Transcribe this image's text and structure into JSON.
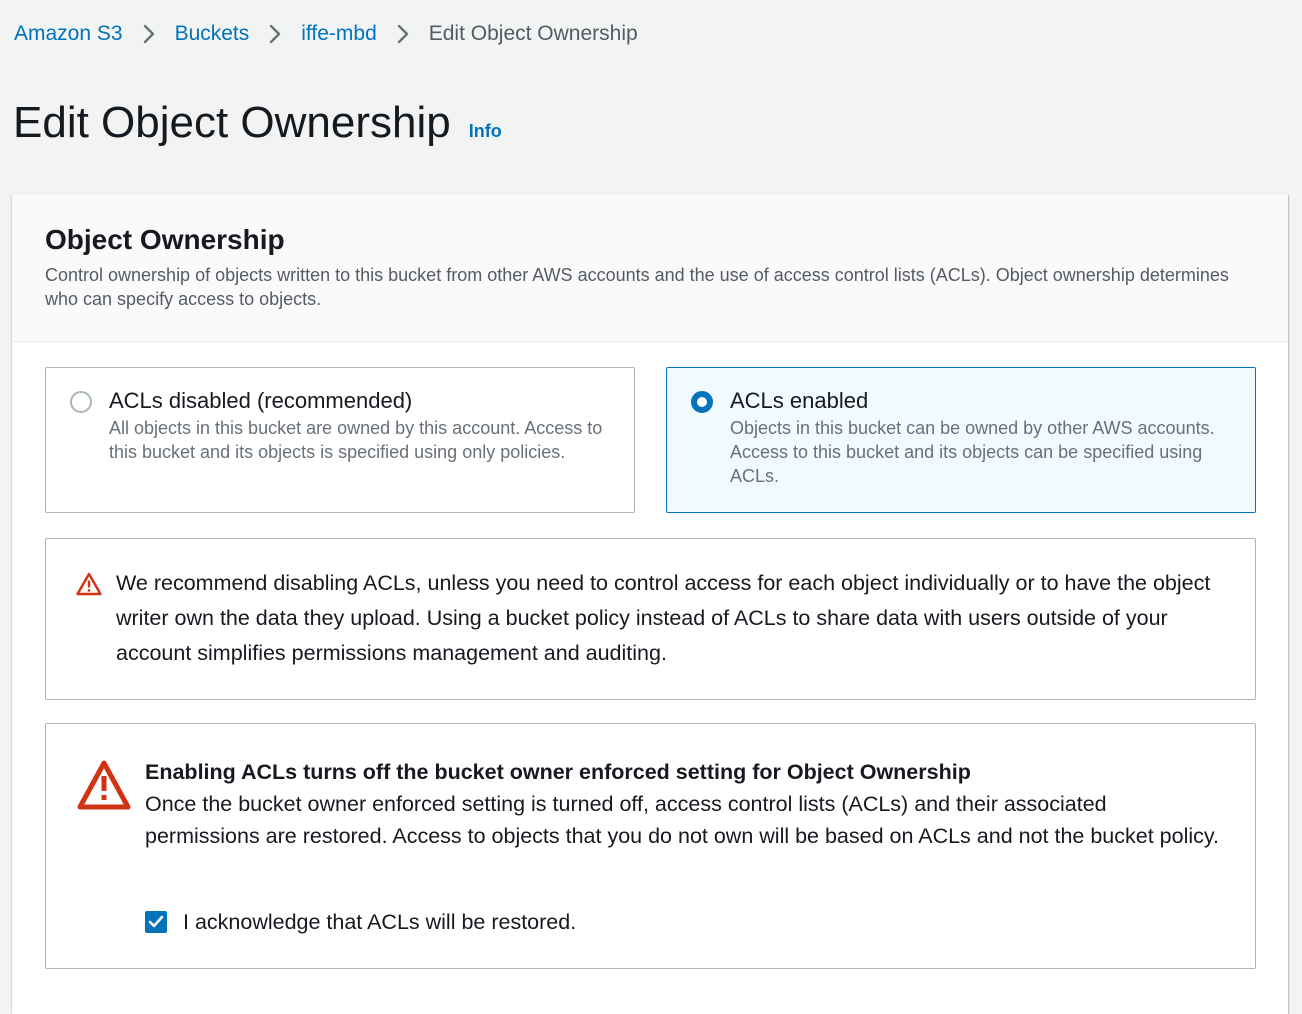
{
  "breadcrumb": {
    "items": [
      "Amazon S3",
      "Buckets",
      "iffe-mbd"
    ],
    "current": "Edit Object Ownership"
  },
  "page": {
    "title": "Edit Object Ownership",
    "info_label": "Info"
  },
  "panel": {
    "title": "Object Ownership",
    "description": "Control ownership of objects written to this bucket from other AWS accounts and the use of access control lists (ACLs). Object ownership determines who can specify access to objects."
  },
  "options": [
    {
      "label": "ACLs disabled (recommended)",
      "description": "All objects in this bucket are owned by this account. Access to this bucket and its objects is specified using only policies.",
      "selected": false
    },
    {
      "label": "ACLs enabled",
      "description": "Objects in this bucket can be owned by other AWS accounts. Access to this bucket and its objects can be specified using ACLs.",
      "selected": true
    }
  ],
  "recommendation_alert": {
    "icon": "warning-icon",
    "text": "We recommend disabling ACLs, unless you need to control access for each object individually or to have the object writer own the data they upload. Using a bucket policy instead of ACLs to share data with users outside of your account simplifies permissions management and auditing."
  },
  "acl_warning": {
    "icon": "warning-icon",
    "title": "Enabling ACLs turns off the bucket owner enforced setting for Object Ownership",
    "body": "Once the bucket owner enforced setting is turned off, access control lists (ACLs) and their associated permissions are restored. Access to objects that you do not own will be based on ACLs and not the bucket policy.",
    "acknowledge_label": "I acknowledge that ACLs will be restored.",
    "acknowledged": true
  },
  "colors": {
    "link": "#0073bb",
    "selected_border": "#0073bb",
    "selected_bg": "#f1faff",
    "warning": "#d13212",
    "page_bg": "#f2f3f3"
  }
}
